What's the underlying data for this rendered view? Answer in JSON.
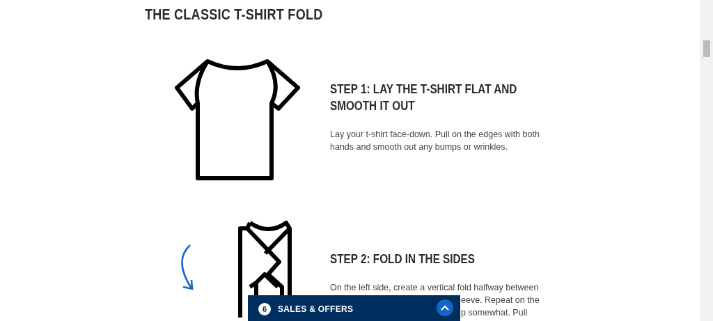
{
  "title": "THE CLASSIC T-SHIRT FOLD",
  "steps": [
    {
      "heading": "STEP 1: LAY THE T-SHIRT FLAT AND SMOOTH IT OUT",
      "lines": [
        {
          "kind": "full",
          "text": "Lay your t-shirt face-down. Pull on the edges with both hands and smooth out any bumps or wrinkles."
        }
      ]
    },
    {
      "heading": "STEP 2: FOLD IN THE SIDES",
      "lines": [
        {
          "kind": "full",
          "text": "On the left side, create a vertical fold halfway between"
        },
        {
          "kind": "partial",
          "text": "eeve. Repeat on the"
        },
        {
          "kind": "partial",
          "text": "p somewhat. Pull"
        }
      ]
    }
  ],
  "offers_bar": {
    "count": "6",
    "label": "SALES & OFFERS",
    "expanded": false
  }
}
